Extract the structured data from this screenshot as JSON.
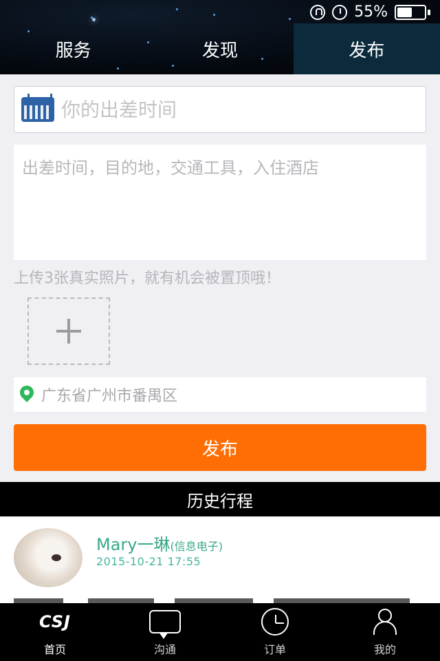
{
  "status_bar": {
    "battery_percent_text": "55%",
    "battery_level": 0.55,
    "icons": [
      "rotation-lock-icon",
      "alarm-icon",
      "battery-icon"
    ]
  },
  "top_tabs": [
    {
      "label": "服务",
      "active": false
    },
    {
      "label": "发现",
      "active": false
    },
    {
      "label": "发布",
      "active": true
    }
  ],
  "form": {
    "date_placeholder": "你的出差时间",
    "detail_placeholder": "出差时间，目的地，交通工具，入住酒店",
    "hint": "上传3张真实照片，就有机会被置顶哦！",
    "location": "广东省广州市番禺区",
    "submit_label": "发布"
  },
  "history": {
    "title": "历史行程",
    "items": [
      {
        "name": "Mary一琳",
        "org": "(信息电子)",
        "time": "2015-10-21  17:55"
      }
    ]
  },
  "bottom_nav": [
    {
      "label": "首页",
      "icon": "logo-icon",
      "active": true,
      "logo_text": "CSJ"
    },
    {
      "label": "沟通",
      "icon": "chat-icon",
      "active": false
    },
    {
      "label": "订单",
      "icon": "clock-icon",
      "active": false
    },
    {
      "label": "我的",
      "icon": "user-icon",
      "active": false
    }
  ],
  "colors": {
    "accent": "#ff6d05",
    "active_tab_bg": "#0b2b3c",
    "username_green": "#3aa88b",
    "location_pin": "#2fb65a"
  }
}
